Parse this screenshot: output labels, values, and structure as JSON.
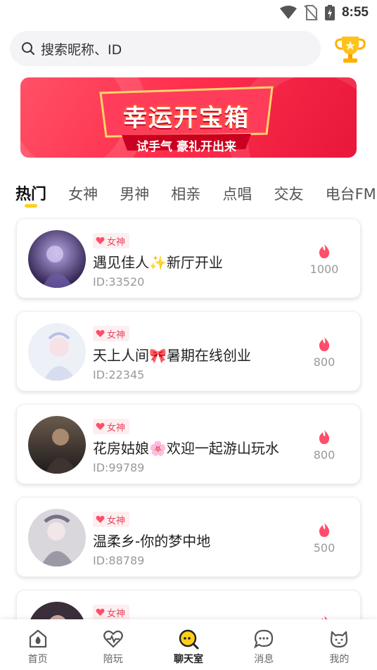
{
  "status_bar": {
    "time": "8:55",
    "icons": [
      "wifi-icon",
      "no-sim-icon",
      "battery-charging-icon"
    ]
  },
  "search": {
    "placeholder": "搜索昵称、ID",
    "icon": "search-icon"
  },
  "trophy_icon": "trophy-icon",
  "banner": {
    "title": "幸运开宝箱",
    "subtitle": "试手气 豪礼开出来"
  },
  "tabs": [
    {
      "label": "热门",
      "active": true
    },
    {
      "label": "女神"
    },
    {
      "label": "男神"
    },
    {
      "label": "相亲"
    },
    {
      "label": "点唱"
    },
    {
      "label": "交友"
    },
    {
      "label": "电台FM"
    }
  ],
  "rooms": [
    {
      "tag": "女神",
      "name": "遇见佳人",
      "emoji": "✨",
      "name_suffix": "新厅开业",
      "id": "ID:33520",
      "heat": "1000"
    },
    {
      "tag": "女神",
      "name": "天上人间",
      "emoji": "🎀",
      "name_suffix": "暑期在线创业",
      "id": "ID:22345",
      "heat": "800"
    },
    {
      "tag": "女神",
      "name": "花房姑娘",
      "emoji": "🌸",
      "name_suffix": "欢迎一起游山玩水",
      "id": "ID:99789",
      "heat": "800"
    },
    {
      "tag": "女神",
      "name": "温柔乡-你的梦中地",
      "emoji": "",
      "name_suffix": "",
      "id": "ID:88789",
      "heat": "500"
    },
    {
      "tag": "女神",
      "name": "",
      "emoji": "",
      "name_suffix": "",
      "id": "",
      "heat": ""
    }
  ],
  "nav": [
    {
      "label": "首页",
      "icon": "home-icon"
    },
    {
      "label": "陪玩",
      "icon": "heartbeat-icon"
    },
    {
      "label": "聊天室",
      "icon": "chatroom-icon",
      "active": true
    },
    {
      "label": "消息",
      "icon": "message-icon"
    },
    {
      "label": "我的",
      "icon": "profile-icon"
    }
  ],
  "colors": {
    "accent": "#ffcf1a",
    "banner_red": "#ff2f4d",
    "tag_pink": "#e8485f",
    "flame": "#ff4d6a"
  }
}
